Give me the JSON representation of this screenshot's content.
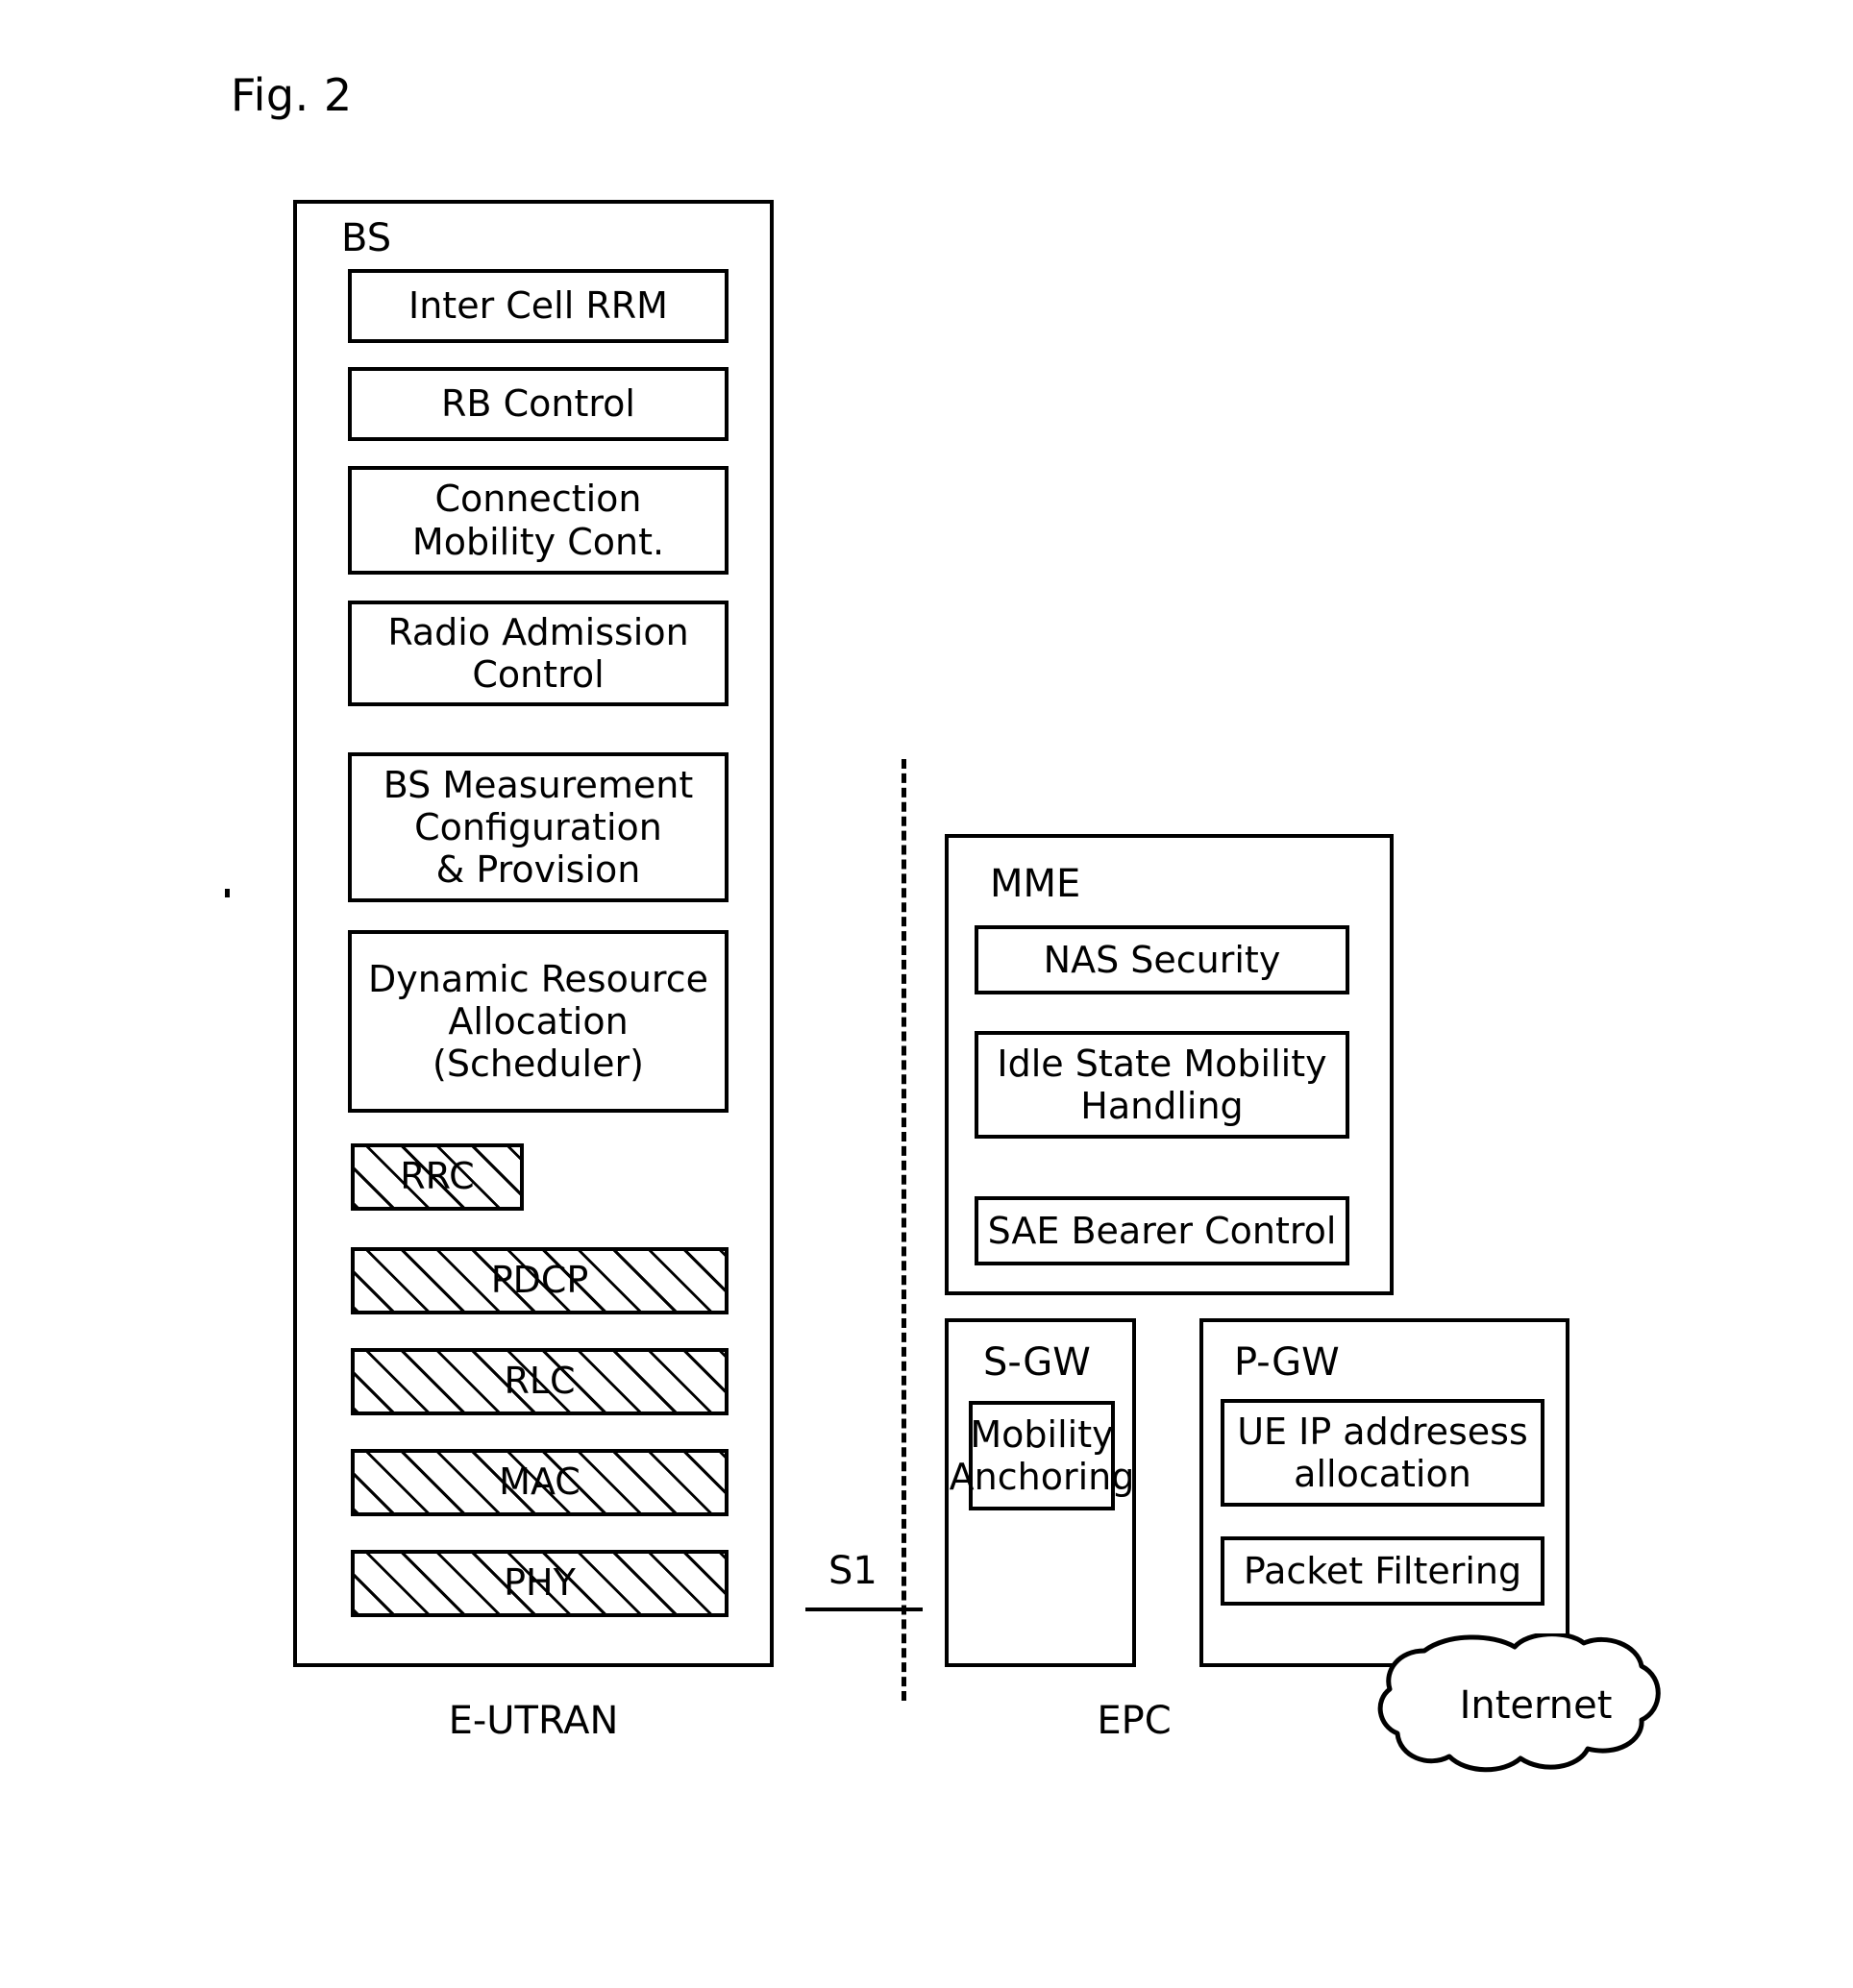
{
  "figure": {
    "label": "Fig. 2"
  },
  "bs": {
    "title": "BS",
    "caption": "E-UTRAN",
    "functions": [
      {
        "lines": [
          "Inter Cell RRM"
        ]
      },
      {
        "lines": [
          "RB Control"
        ]
      },
      {
        "lines": [
          "Connection",
          "Mobility Cont."
        ]
      },
      {
        "lines": [
          "Radio Admission",
          "Control"
        ]
      },
      {
        "lines": [
          "BS Measurement",
          "Configuration",
          "& Provision"
        ]
      },
      {
        "lines": [
          "Dynamic Resource",
          "Allocation",
          "(Scheduler)"
        ]
      }
    ],
    "protocol_stack": [
      {
        "label": "RRC"
      },
      {
        "label": "PDCP"
      },
      {
        "label": "RLC"
      },
      {
        "label": "MAC"
      },
      {
        "label": "PHY"
      }
    ]
  },
  "interface": {
    "name": "S1"
  },
  "epc": {
    "caption": "EPC",
    "mme": {
      "title": "MME",
      "functions": [
        {
          "lines": [
            "NAS Security"
          ]
        },
        {
          "lines": [
            "Idle State Mobility",
            "Handling"
          ]
        },
        {
          "lines": [
            "SAE Bearer Control"
          ]
        }
      ]
    },
    "sgw": {
      "title": "S-GW",
      "functions": [
        {
          "lines": [
            "Mobility",
            "Anchoring"
          ]
        }
      ]
    },
    "pgw": {
      "title": "P-GW",
      "functions": [
        {
          "lines": [
            "UE IP addresess",
            "allocation"
          ]
        },
        {
          "lines": [
            "Packet Filtering"
          ]
        }
      ]
    }
  },
  "internet": {
    "label": "Internet"
  },
  "colors": {
    "stroke": "#000000",
    "background": "#ffffff"
  }
}
